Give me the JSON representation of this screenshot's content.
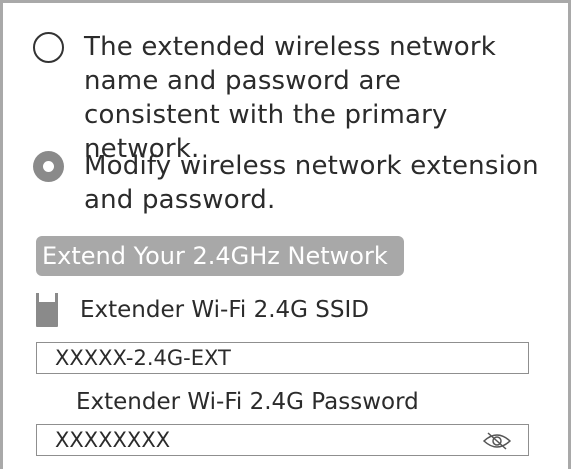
{
  "options": [
    {
      "label": "The extended wireless network name and password are consistent with the primary network.",
      "selected": false
    },
    {
      "label": "Modify wireless network extension and password.",
      "selected": true
    }
  ],
  "section": {
    "title": "Extend Your 2.4GHz Network"
  },
  "ssid": {
    "label": "Extender Wi-Fi 2.4G SSID",
    "value": "XXXXX-2.4G-EXT"
  },
  "password": {
    "label": "Extender Wi-Fi 2.4G Password",
    "value": "XXXXXXXX"
  },
  "icons": {
    "extender": "wifi-extender-icon",
    "toggle_visibility": "eye-slash-icon"
  },
  "colors": {
    "border": "#a9a9a9",
    "header_bg": "#a8a8a8",
    "radio_checked": "#8a8a8a",
    "text": "#2b2b2b"
  }
}
